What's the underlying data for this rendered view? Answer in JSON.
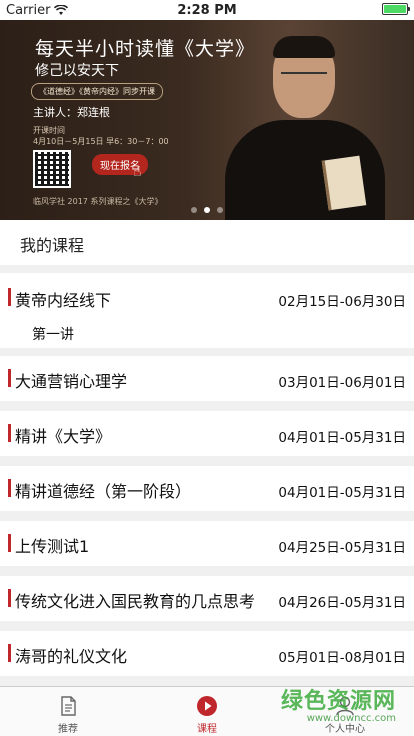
{
  "status_bar": {
    "carrier": "Carrier",
    "time": "2:28 PM"
  },
  "banner": {
    "title": "每天半小时读懂《大学》",
    "subtitle": "修己以安天下",
    "tag": "《道德经》《黄帝内经》同步开课",
    "lecturer": "主讲人：郑连根",
    "schedule_label": "开课时间",
    "schedule": "4月10日－5月15日 早6：30－7：00",
    "signup_button": "现在报名",
    "footer": "临风学社 2017 系列课程之《大学》",
    "slide_count": 3,
    "active_slide": 2
  },
  "section": {
    "title": "我的课程"
  },
  "courses": [
    {
      "name": "黄帝内经线下",
      "date": "02月15日-06月30日",
      "lesson": "第一讲"
    },
    {
      "name": "大通营销心理学",
      "date": "03月01日-06月01日"
    },
    {
      "name": "精讲《大学》",
      "date": "04月01日-05月31日"
    },
    {
      "name": "精讲道德经（第一阶段）",
      "date": "04月01日-05月31日"
    },
    {
      "name": "上传测试1",
      "date": "04月25日-05月31日"
    },
    {
      "name": "传统文化进入国民教育的几点思考",
      "date": "04月26日-05月31日"
    },
    {
      "name": "涛哥的礼仪文化",
      "date": "05月01日-08月01日"
    }
  ],
  "tabs": [
    {
      "label": "推荐",
      "icon": "document-icon"
    },
    {
      "label": "课程",
      "icon": "play-icon",
      "active": true
    },
    {
      "label": "个人中心",
      "icon": "person-icon"
    }
  ],
  "watermark": {
    "main": "绿色资源网",
    "sub": "www.downcc.com"
  },
  "colors": {
    "accent": "#c0272d",
    "watermark": "#3caa3c"
  }
}
